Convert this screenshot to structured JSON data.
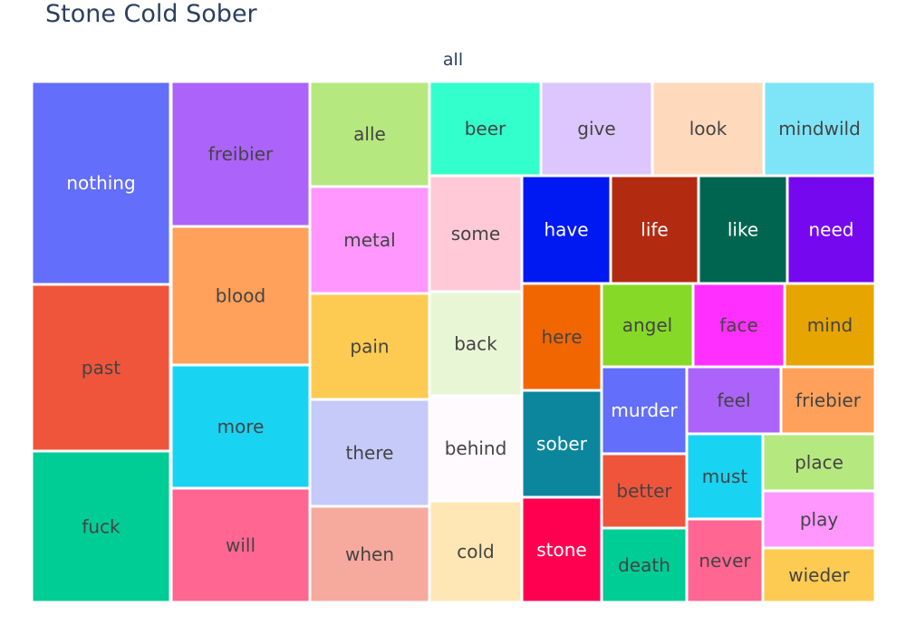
{
  "chart_data": {
    "type": "treemap",
    "title": "Stone Cold Sober",
    "root": "all",
    "items": [
      {
        "label": "nothing",
        "value": 2,
        "color": "#636efa",
        "text_color": "#ffffff"
      },
      {
        "label": "past",
        "value": 2,
        "color": "#ef553b",
        "text_color": "#444444"
      },
      {
        "label": "fuck",
        "value": 2,
        "color": "#00cc96",
        "text_color": "#444444"
      },
      {
        "label": "freibier",
        "value": 2,
        "color": "#ab63fa",
        "text_color": "#444444"
      },
      {
        "label": "blood",
        "value": 2,
        "color": "#ffa15a",
        "text_color": "#444444"
      },
      {
        "label": "more",
        "value": 2,
        "color": "#19d3f3",
        "text_color": "#444444"
      },
      {
        "label": "will",
        "value": 2,
        "color": "#ff6692",
        "text_color": "#444444"
      },
      {
        "label": "alle",
        "value": 1,
        "color": "#b6e880",
        "text_color": "#444444"
      },
      {
        "label": "metal",
        "value": 1,
        "color": "#ff97ff",
        "text_color": "#444444"
      },
      {
        "label": "pain",
        "value": 1,
        "color": "#fecb52",
        "text_color": "#444444"
      },
      {
        "label": "there",
        "value": 1,
        "color": "#c6caf9",
        "text_color": "#444444"
      },
      {
        "label": "when",
        "value": 1,
        "color": "#f6a99d",
        "text_color": "#444444"
      },
      {
        "label": "beer",
        "value": 1,
        "color": "#33ffcc",
        "text_color": "#444444"
      },
      {
        "label": "give",
        "value": 1,
        "color": "#ddc5fd",
        "text_color": "#444444"
      },
      {
        "label": "look",
        "value": 1,
        "color": "#ffd9bc",
        "text_color": "#444444"
      },
      {
        "label": "mindwild",
        "value": 1,
        "color": "#7ee5f8",
        "text_color": "#444444"
      },
      {
        "label": "some",
        "value": 1,
        "color": "#ffc9d8",
        "text_color": "#444444"
      },
      {
        "label": "back",
        "value": 1,
        "color": "#e9f6d6",
        "text_color": "#444444"
      },
      {
        "label": "behind",
        "value": 1,
        "color": "#fefafe",
        "text_color": "#444444"
      },
      {
        "label": "cold",
        "value": 1,
        "color": "#ffe7b5",
        "text_color": "#444444"
      },
      {
        "label": "have",
        "value": 1,
        "color": "#0019f2",
        "text_color": "#ffffff"
      },
      {
        "label": "life",
        "value": 1,
        "color": "#b22b11",
        "text_color": "#ffffff"
      },
      {
        "label": "like",
        "value": 1,
        "color": "#006550",
        "text_color": "#ffffff"
      },
      {
        "label": "need",
        "value": 1,
        "color": "#7608f0",
        "text_color": "#ffffff"
      },
      {
        "label": "here",
        "value": 1,
        "color": "#f26600",
        "text_color": "#444444"
      },
      {
        "label": "angel",
        "value": 1,
        "color": "#86da27",
        "text_color": "#444444"
      },
      {
        "label": "face",
        "value": 1,
        "color": "#ff30ff",
        "text_color": "#444444"
      },
      {
        "label": "mind",
        "value": 1,
        "color": "#e6a500",
        "text_color": "#444444"
      },
      {
        "label": "sober",
        "value": 1,
        "color": "#0b869c",
        "text_color": "#ffffff"
      },
      {
        "label": "murder",
        "value": 1,
        "color": "#636efa",
        "text_color": "#ffffff"
      },
      {
        "label": "feel",
        "value": 1,
        "color": "#ab63fa",
        "text_color": "#444444"
      },
      {
        "label": "friebier",
        "value": 1,
        "color": "#ffa15a",
        "text_color": "#444444"
      },
      {
        "label": "better",
        "value": 1,
        "color": "#ef553b",
        "text_color": "#444444"
      },
      {
        "label": "must",
        "value": 1,
        "color": "#19d3f3",
        "text_color": "#444444"
      },
      {
        "label": "place",
        "value": 1,
        "color": "#b6e880",
        "text_color": "#444444"
      },
      {
        "label": "play",
        "value": 1,
        "color": "#ff97ff",
        "text_color": "#444444"
      },
      {
        "label": "stone",
        "value": 1,
        "color": "#ff0050",
        "text_color": "#ffffff"
      },
      {
        "label": "death",
        "value": 1,
        "color": "#00cc96",
        "text_color": "#444444"
      },
      {
        "label": "never",
        "value": 1,
        "color": "#ff6692",
        "text_color": "#444444"
      },
      {
        "label": "wieder",
        "value": 1,
        "color": "#fecb52",
        "text_color": "#444444"
      }
    ]
  }
}
